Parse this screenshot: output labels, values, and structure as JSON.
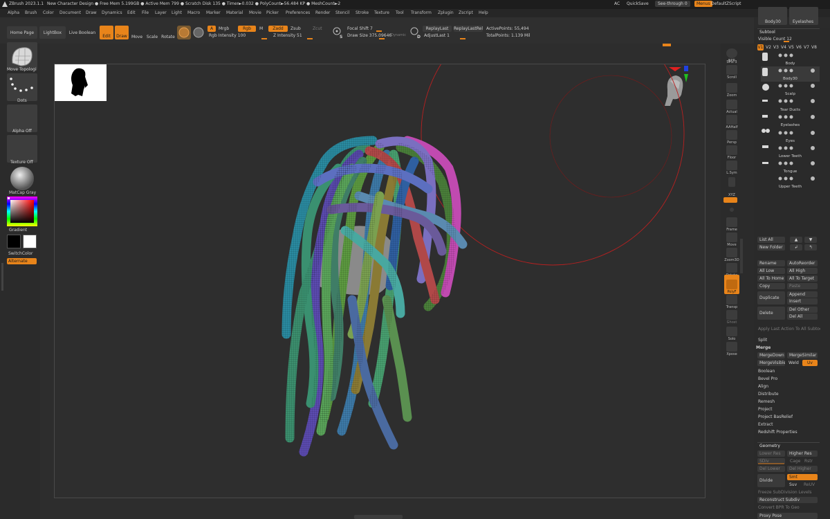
{
  "titlebar": {
    "app": "ZBrush 2023.1.1",
    "doc": "New Character Design",
    "stats": "● Free Mem 5.199GB ● Active Mem 799 ● Scratch Disk 135 ● Timer►0.032 ● PolyCount►56.484 KP ● MeshCount►2",
    "ac": "AC",
    "quicksave": "QuickSave",
    "seethrough": "See-through  0",
    "menus": "Menus",
    "zscript": "DefaultZScript"
  },
  "menubar": [
    "Alpha",
    "Brush",
    "Color",
    "Document",
    "Draw",
    "Dynamics",
    "Edit",
    "File",
    "Layer",
    "Light",
    "Macro",
    "Marker",
    "Material",
    "Movie",
    "Picker",
    "Preferences",
    "Render",
    "Stencil",
    "Stroke",
    "Texture",
    "Tool",
    "Transform",
    "Zplugin",
    "Zscript",
    "Help"
  ],
  "toolbar": {
    "home": "Home Page",
    "lightbox": "LightBox",
    "liveboolean": "Live Boolean",
    "edit": "Edit",
    "draw": "Draw",
    "move": "Move",
    "scale": "Scale",
    "rotate": "Rotate",
    "a": "A",
    "mrgb": "Mrgb",
    "rgb": "Rgb",
    "m": "M",
    "rgb_intensity": "Rgb Intensity 100",
    "zadd": "Zadd",
    "zsub": "Zsub",
    "zcut": "Zcut",
    "z_intensity": "Z Intensity 51",
    "focal_shift": "Focal Shift 7",
    "draw_size": "Draw Size 375.09646",
    "dynamic": "Dynamic",
    "replaylast": "ReplayLast",
    "replaylastrel": "ReplayLastRel",
    "adjustlast": "AdjustLast 1",
    "activepoints": "ActivePoints: 55,494",
    "totalpoints": "TotalPoints: 1.139 Mil",
    "s": "S",
    "d": "D"
  },
  "leftshelf": {
    "brush": "Move Topologi",
    "stroke": "Dots",
    "alpha": "Alpha Off",
    "texture": "Texture Off",
    "material": "MatCap Gray",
    "gradient": "Gradient",
    "switchcolor": "SwitchColor",
    "alternate": "Alternate"
  },
  "rightshelf": [
    "BPR",
    "SPix 3",
    "Scroll",
    "Zoom",
    "Actual",
    "AAHalf",
    "Persp",
    "Floor",
    "L.Sym",
    "",
    "XYZ",
    "",
    "",
    "Frame",
    "Move",
    "Zoom3D",
    "Rotate",
    "PolyF",
    "Transp",
    "Ghost",
    "Solo",
    "Xpose"
  ],
  "subtool": {
    "header": "Subtool",
    "visible_count": "Visible Count  12",
    "vtabs": [
      "V1",
      "V2",
      "V3",
      "V4",
      "V5",
      "V6",
      "V7",
      "V8"
    ],
    "items": [
      "Body",
      "Body30",
      "Scalp",
      "Tear Ducts",
      "Eyelashes",
      "Eyes",
      "Lower Teeth",
      "Tongue",
      "Upper Teeth"
    ],
    "top_thumbs": [
      "Body30",
      "Eyelashes"
    ],
    "list_all": "List All",
    "new_folder": "New Folder",
    "rename": "Rename",
    "autoreorder": "AutoReorder",
    "all_low": "All Low",
    "all_high": "All High",
    "all_to_home": "All To Home",
    "all_to_target": "All To Target",
    "copy": "Copy",
    "paste": "Paste",
    "duplicate": "Duplicate",
    "append": "Append",
    "insert": "Insert",
    "delete": "Delete",
    "del_other": "Del Other",
    "del_all": "Del All",
    "apply_last": "Apply Last Action To All Subtool",
    "split": "Split",
    "merge": "Merge",
    "mergedown": "MergeDown",
    "mergesimilar": "MergeSimilar",
    "mergevisible": "MergeVisible",
    "weld": "Weld",
    "uv": "Uv",
    "sections": [
      "Boolean",
      "Bevel Pro",
      "Align",
      "Distribute",
      "Remesh",
      "Project",
      "Project BasRelief",
      "Extract",
      "Redshift Properties"
    ]
  },
  "geometry": {
    "header": "Geometry",
    "lower_res": "Lower Res",
    "higher_res": "Higher Res",
    "sdiv": "SDiv",
    "cage": "Cage",
    "rstr": "Rstr",
    "del_lower": "Del Lower",
    "del_higher": "Del Higher",
    "divide": "Divide",
    "smt": "Smt",
    "suv": "Suv",
    "reuv": "ReUV",
    "freeze": "Freeze SubDivision Levels",
    "reconstruct": "Reconstruct Subdiv",
    "convert_bpr": "Convert BPR To Geo",
    "proxy_pose": "Proxy Pose"
  }
}
